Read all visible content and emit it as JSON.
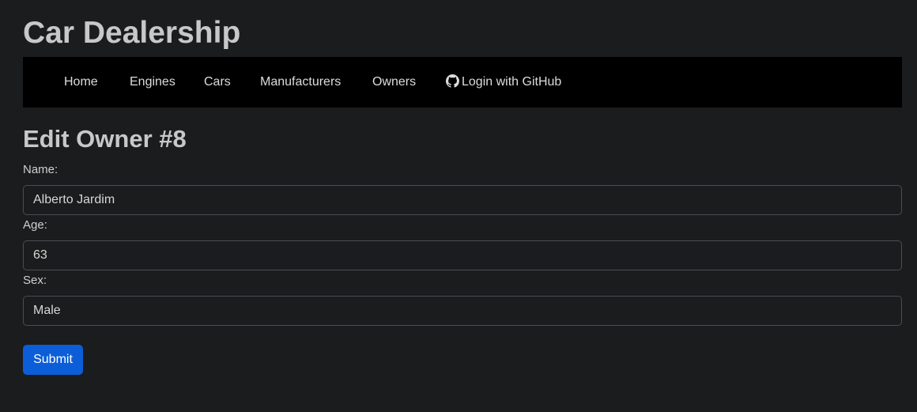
{
  "site": {
    "title": "Car Dealership"
  },
  "nav": {
    "items": [
      {
        "label": "Home"
      },
      {
        "label": "Engines"
      },
      {
        "label": "Cars"
      },
      {
        "label": "Manufacturers"
      },
      {
        "label": "Owners"
      }
    ],
    "login": {
      "label": "Login with GitHub",
      "icon": "github-icon"
    }
  },
  "page": {
    "heading": "Edit Owner #8"
  },
  "form": {
    "name": {
      "label": "Name:",
      "value": "Alberto Jardim"
    },
    "age": {
      "label": "Age:",
      "value": "63"
    },
    "sex": {
      "label": "Sex:",
      "value": "Male"
    },
    "submit_label": "Submit"
  },
  "colors": {
    "background": "#1b1c1e",
    "navbar": "#000000",
    "primary_button": "#0b5ed7",
    "input_border": "#4a4d52"
  }
}
